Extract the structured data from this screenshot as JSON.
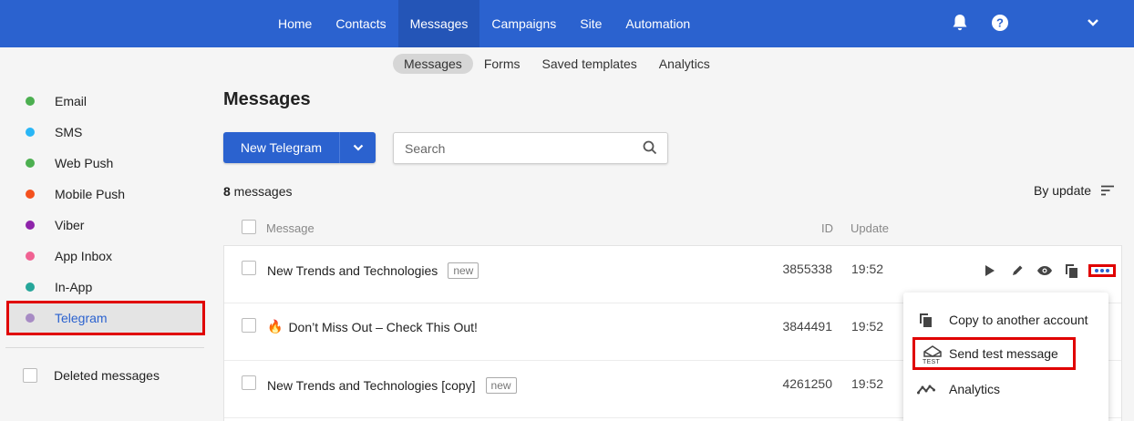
{
  "topnav": {
    "items": [
      "Home",
      "Contacts",
      "Messages",
      "Campaigns",
      "Site",
      "Automation"
    ],
    "active": "Messages",
    "icons": [
      "bell-icon",
      "help-icon",
      "chevron-down-icon"
    ]
  },
  "subnav": {
    "items": [
      "Messages",
      "Forms",
      "Saved templates",
      "Analytics"
    ],
    "active": "Messages"
  },
  "sidebar": {
    "items": [
      {
        "label": "Email",
        "color": "#4caf50"
      },
      {
        "label": "SMS",
        "color": "#29b6f6"
      },
      {
        "label": "Web Push",
        "color": "#4caf50"
      },
      {
        "label": "Mobile Push",
        "color": "#f4511e"
      },
      {
        "label": "Viber",
        "color": "#8e24aa"
      },
      {
        "label": "App Inbox",
        "color": "#f06292"
      },
      {
        "label": "In-App",
        "color": "#26a69a"
      },
      {
        "label": "Telegram",
        "color": "#a78bc4"
      }
    ],
    "active": "Telegram",
    "deleted_label": "Deleted messages"
  },
  "main": {
    "title": "Messages",
    "new_button": "New Telegram",
    "search_placeholder": "Search",
    "count_number": "8",
    "count_suffix": " messages",
    "sort_label": "By update",
    "columns": {
      "message": "Message",
      "id": "ID",
      "update": "Update"
    },
    "rows": [
      {
        "name": "New Trends and Technologies",
        "badge": "new",
        "id": "3855338",
        "time": "19:52"
      },
      {
        "emoji": "🔥",
        "name": "Don’t Miss Out – Check This Out!",
        "id": "3844491",
        "time": "19:52"
      },
      {
        "name": "New Trends and Technologies [copy]",
        "badge": "new",
        "id": "4261250",
        "time": "19:52"
      }
    ]
  },
  "menu": {
    "items": [
      {
        "label": "Copy to another account",
        "icon": "copy-icon"
      },
      {
        "label": "Send test message",
        "icon": "test-envelope-icon",
        "icon_text": "TEST"
      },
      {
        "label": "Analytics",
        "icon": "analytics-icon"
      }
    ]
  },
  "colors": {
    "brand": "#2b62cf",
    "highlight": "#e00000"
  }
}
